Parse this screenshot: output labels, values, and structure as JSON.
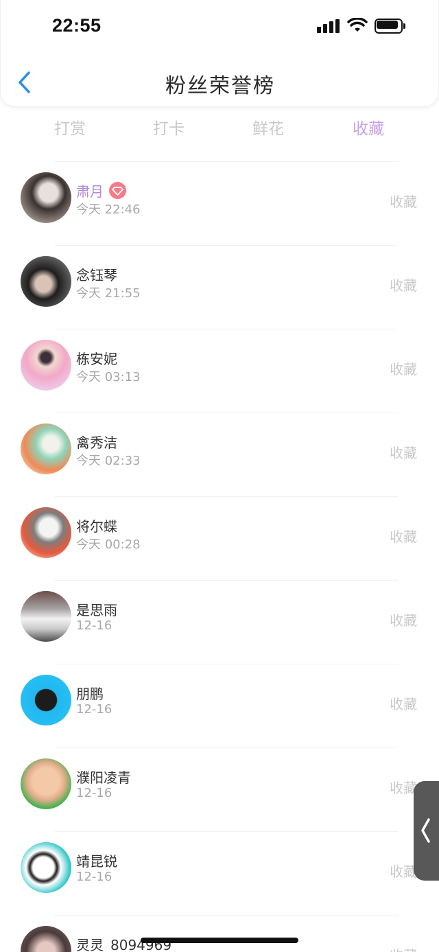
{
  "status_bar": {
    "time": "22:55"
  },
  "header": {
    "title": "粉丝荣誉榜",
    "back_icon": "chevron-left-icon"
  },
  "colors": {
    "accent": "#c9a2e6",
    "vip_name": "#b48ad8",
    "badge": "#f47b87",
    "back": "#2d8fe4"
  },
  "tabs": [
    {
      "label": "打赏",
      "active": false
    },
    {
      "label": "打卡",
      "active": false
    },
    {
      "label": "鲜花",
      "active": false
    },
    {
      "label": "收藏",
      "active": true
    }
  ],
  "list": [
    {
      "name": "肃月",
      "time": "今天 22:46",
      "action": "收藏",
      "vip": true
    },
    {
      "name": "念钰琴",
      "time": "今天 21:55",
      "action": "收藏"
    },
    {
      "name": "栋安妮",
      "time": "今天 03:13",
      "action": "收藏"
    },
    {
      "name": "禽秀洁",
      "time": "今天 02:33",
      "action": "收藏"
    },
    {
      "name": "将尔蝶",
      "time": "今天 00:28",
      "action": "收藏"
    },
    {
      "name": "是思雨",
      "time": "12-16",
      "action": "收藏"
    },
    {
      "name": "朋鹏",
      "time": "12-16",
      "action": "收藏"
    },
    {
      "name": "濮阳凌青",
      "time": "12-16",
      "action": "收藏"
    },
    {
      "name": "靖昆锐",
      "time": "12-16",
      "action": "收藏"
    },
    {
      "name": "灵灵_8094969",
      "time": "",
      "action": "收藏"
    }
  ]
}
